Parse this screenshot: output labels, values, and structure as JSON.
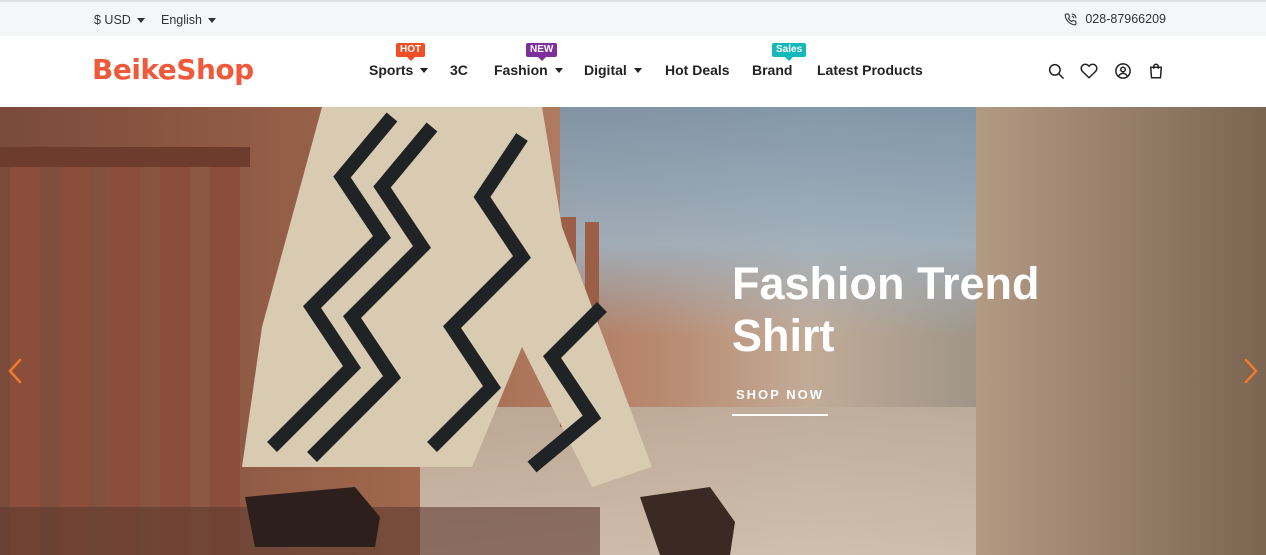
{
  "topbar": {
    "currency": "$ USD",
    "language": "English",
    "phone": "028-87966209"
  },
  "header": {
    "logo": "BeikeShop",
    "nav": [
      {
        "label": "Sports",
        "badge": "HOT",
        "dropdown": true
      },
      {
        "label": "3C"
      },
      {
        "label": "Fashion",
        "badge": "NEW",
        "dropdown": true
      },
      {
        "label": "Digital",
        "dropdown": true
      },
      {
        "label": "Hot Deals"
      },
      {
        "label": "Brand",
        "badge": "Sales"
      },
      {
        "label": "Latest Products"
      }
    ],
    "icons": [
      "search-icon",
      "heart-icon",
      "user-icon",
      "bag-icon"
    ]
  },
  "hero": {
    "title": "Fashion Trend Shirt",
    "button": "SHOP NOW"
  },
  "colors": {
    "brand": "#ef5a3c",
    "badge_hot": "#ef4e26",
    "badge_new": "#7d2f9c",
    "badge_sales": "#13b8bb",
    "arrow": "#f07a2a"
  }
}
